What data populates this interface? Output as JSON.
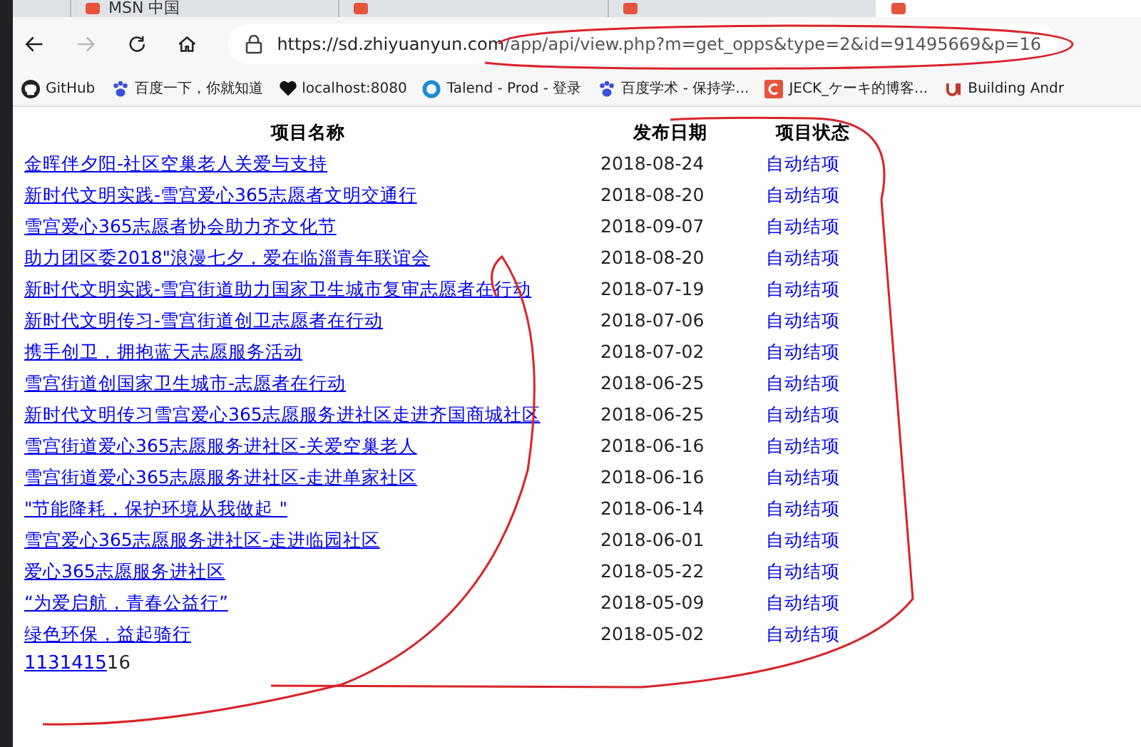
{
  "tabs": [
    {
      "title": "MSN 中国",
      "selected": false
    },
    {
      "selected": false
    },
    {
      "selected": false
    },
    {
      "selected": true
    }
  ],
  "address_bar": {
    "url_host": "https://sd.zhiyuanyun.com",
    "url_path": "/app/api/view.php?m=get_opps&type=2&id=91495669&p=16"
  },
  "bookmarks": [
    {
      "kind": "github",
      "label": "GitHub"
    },
    {
      "kind": "paw",
      "label": "百度一下，你就知道"
    },
    {
      "kind": "heart",
      "label": "localhost:8080"
    },
    {
      "kind": "ring",
      "label": "Talend - Prod - 登录"
    },
    {
      "kind": "paw",
      "label": "百度学术 - 保持学..."
    },
    {
      "kind": "csdn",
      "label": "JECK_ケーキ的博客..."
    },
    {
      "kind": "u",
      "label": "Building Andr"
    }
  ],
  "table": {
    "columns": [
      "项目名称",
      "发布日期",
      "项目状态"
    ],
    "rows": [
      {
        "name": "金晖伴夕阳-社区空巢老人关爱与支持",
        "date": "2018-08-24",
        "status": "自动结项"
      },
      {
        "name": "新时代文明实践-雪宫爱心365志愿者文明交通行",
        "date": "2018-08-20",
        "status": "自动结项"
      },
      {
        "name": "雪宫爱心365志愿者协会助力齐文化节",
        "date": "2018-09-07",
        "status": "自动结项"
      },
      {
        "name": "助力团区委2018\"浪漫七夕，爱在临淄青年联谊会",
        "date": "2018-08-20",
        "status": "自动结项"
      },
      {
        "name": "新时代文明实践-雪宫街道助力国家卫生城市复审志愿者在行动",
        "date": "2018-07-19",
        "status": "自动结项"
      },
      {
        "name": "新时代文明传习-雪宫街道创卫志愿者在行动",
        "date": "2018-07-06",
        "status": "自动结项"
      },
      {
        "name": "携手创卫，拥抱蓝天志愿服务活动",
        "date": "2018-07-02",
        "status": "自动结项"
      },
      {
        "name": "雪宫街道创国家卫生城市-志愿者在行动",
        "date": "2018-06-25",
        "status": "自动结项"
      },
      {
        "name": "新时代文明传习雪宫爱心365志愿服务进社区走进齐国商城社区",
        "date": "2018-06-25",
        "status": "自动结项"
      },
      {
        "name": "雪宫街道爱心365志愿服务进社区-关爱空巢老人",
        "date": "2018-06-16",
        "status": "自动结项"
      },
      {
        "name": "雪宫街道爱心365志愿服务进社区-走进单家社区",
        "date": "2018-06-16",
        "status": "自动结项"
      },
      {
        "name": "\"节能降耗，保护环境从我做起 \"",
        "date": "2018-06-14",
        "status": "自动结项"
      },
      {
        "name": "雪宫爱心365志愿服务进社区-走进临园社区",
        "date": "2018-06-01",
        "status": "自动结项"
      },
      {
        "name": "爱心365志愿服务进社区",
        "date": "2018-05-22",
        "status": "自动结项"
      },
      {
        "name": " “为爱启航，青春公益行” ",
        "date": "2018-05-09",
        "status": "自动结项"
      },
      {
        "name": "绿色环保，益起骑行",
        "date": "2018-05-02",
        "status": "自动结项"
      }
    ]
  },
  "pagination": [
    {
      "label": "1",
      "selected": false
    },
    {
      "label": "13",
      "selected": false
    },
    {
      "label": "14",
      "selected": false
    },
    {
      "label": "15",
      "selected": false
    },
    {
      "label": "16",
      "selected": true
    }
  ]
}
